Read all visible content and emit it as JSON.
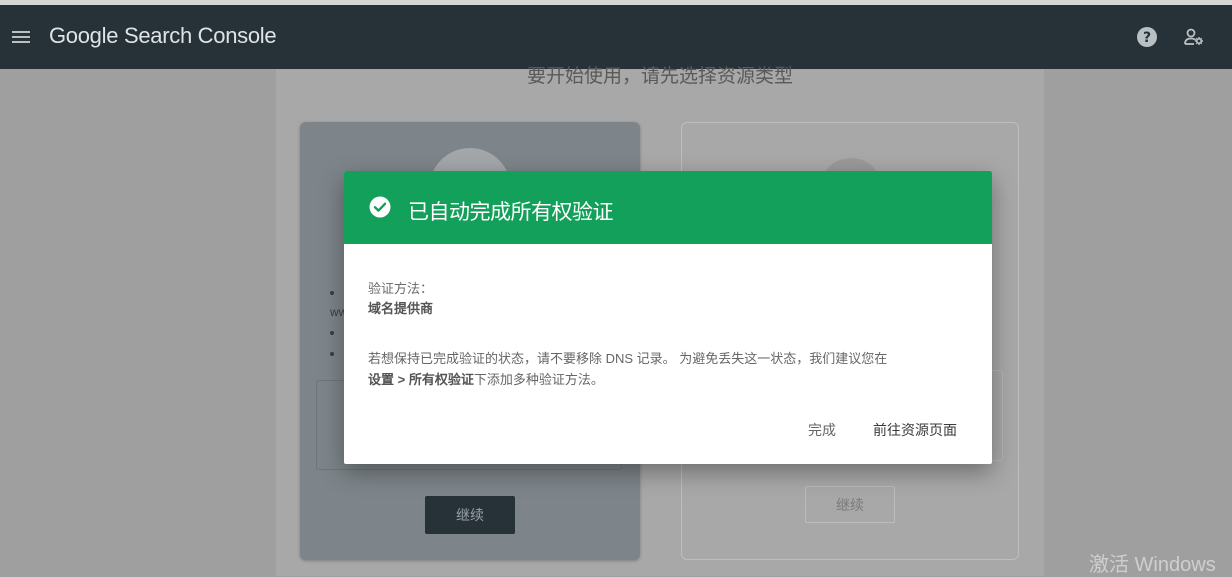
{
  "header": {
    "app_name": "Google Search Console",
    "brand": "Google",
    "product": "Search Console",
    "menu_icon": "hamburger-menu-icon",
    "help_icon": "help-circle-icon",
    "account_icon": "manage-account-icon",
    "background_color": "#263238"
  },
  "background_page": {
    "heading": "要开始使用，请先选择资源类型",
    "left_card": {
      "prefix_fragment": "ww",
      "continue_label": "继续"
    },
    "right_card": {
      "continue_label": "继续"
    }
  },
  "dialog": {
    "title": "已自动完成所有权验证",
    "header_color": "#13a05a",
    "status_icon": "check-circle-icon",
    "method_label": "验证方法：",
    "method_value": "域名提供商",
    "info_part1": "若想保持已完成验证的状态，请不要移除 DNS 记录。 为避免丢失这一状态，我们建议您在",
    "info_bold": "设置 > 所有权验证",
    "info_part2": "下添加多种验证方法。",
    "done_label": "完成",
    "go_to_property_label": "前往资源页面"
  },
  "os_watermark": "激活 Windows"
}
